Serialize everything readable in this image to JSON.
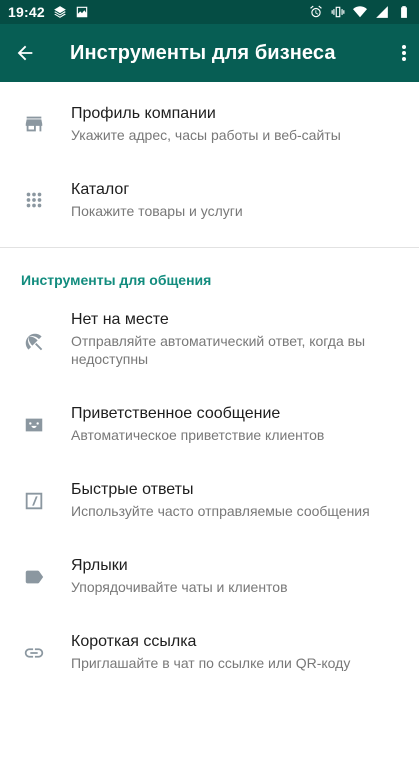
{
  "status_bar": {
    "time": "19:42",
    "left_icons": [
      "layers-icon",
      "gallery-icon"
    ],
    "right_icons": [
      "alarm-icon",
      "vibrate-icon",
      "wifi-icon",
      "signal-icon",
      "battery-icon"
    ]
  },
  "app_bar": {
    "title": "Инструменты для бизнеса",
    "back_icon": "arrow-back-icon",
    "menu_icon": "more-vert-icon",
    "color": "#075e54"
  },
  "business_items": [
    {
      "icon": "store-icon",
      "title": "Профиль компании",
      "subtitle": "Укажите адрес, часы работы и веб-сайты"
    },
    {
      "icon": "grid-dots-icon",
      "title": "Каталог",
      "subtitle": "Покажите товары и услуги"
    }
  ],
  "communication_section": {
    "header": "Инструменты для общения",
    "header_color": "#128c7e",
    "items": [
      {
        "icon": "beach-umbrella-icon",
        "title": "Нет на месте",
        "subtitle": "Отправляйте автоматический ответ, когда вы недоступны"
      },
      {
        "icon": "greeting-icon",
        "title": "Приветственное сообщение",
        "subtitle": "Автоматическое приветствие клиентов"
      },
      {
        "icon": "quick-reply-icon",
        "title": "Быстрые ответы",
        "subtitle": "Используйте часто отправляемые сообщения"
      },
      {
        "icon": "label-icon",
        "title": "Ярлыки",
        "subtitle": "Упорядочивайте чаты и клиентов"
      },
      {
        "icon": "link-icon",
        "title": "Короткая ссылка",
        "subtitle": "Приглашайте в чат по ссылке или QR-коду"
      }
    ]
  }
}
